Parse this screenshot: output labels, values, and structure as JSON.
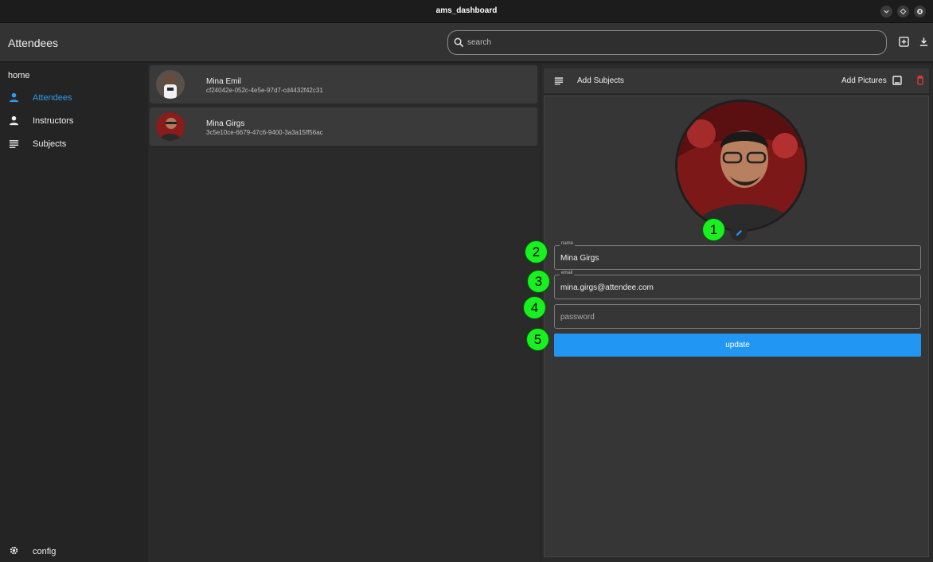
{
  "window": {
    "title": "ams_dashboard"
  },
  "appbar": {
    "title": "Attendees",
    "search_placeholder": "search",
    "icons": [
      "add-box-icon",
      "download-icon"
    ]
  },
  "sidebar": {
    "home_label": "home",
    "items": [
      {
        "label": "Attendees",
        "icon": "person-icon",
        "active": true
      },
      {
        "label": "Instructors",
        "icon": "person-icon",
        "active": false
      },
      {
        "label": "Subjects",
        "icon": "list-icon",
        "active": false
      }
    ],
    "config_label": "config"
  },
  "attendees": [
    {
      "name": "Mina Emil",
      "id": "cf24042e-052c-4e5e-97d7-cd4432f42c31"
    },
    {
      "name": "Mina Girgs",
      "id": "3c5e10ce-6679-47c6-9400-3a3a15ff56ac"
    }
  ],
  "detail": {
    "add_subjects_label": "Add Subjects",
    "add_pictures_label": "Add Pictures",
    "name_label": "name",
    "name_value": "Mina Girgs",
    "email_label": "email",
    "email_value": "mina.girgs@attendee.com",
    "password_placeholder": "password",
    "update_label": "update"
  },
  "markers": [
    "1",
    "2",
    "3",
    "4",
    "5"
  ],
  "colors": {
    "accent": "#2196f3",
    "active_nav": "#2f9ae8",
    "delete": "#e53935",
    "marker": "#19f020"
  }
}
